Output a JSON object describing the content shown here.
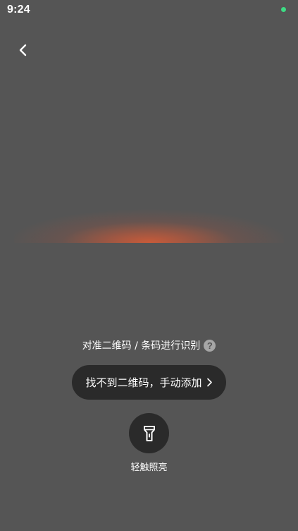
{
  "status_bar": {
    "time": "9:24",
    "indicator_color": "#3ddc84"
  },
  "nav": {
    "back_icon": "chevron-left-icon"
  },
  "scanner": {
    "glow_color": "#e85c32",
    "hint": "对准二维码 / 条码进行识别",
    "help_icon": "question-circle-icon",
    "help_glyph": "?"
  },
  "manual_add": {
    "label": "找不到二维码，手动添加",
    "icon": "chevron-right-icon"
  },
  "flashlight": {
    "icon": "flashlight-icon",
    "label": "轻触照亮"
  },
  "colors": {
    "background": "#555555",
    "button_bg": "#2a2a2a",
    "text": "#ffffff"
  }
}
